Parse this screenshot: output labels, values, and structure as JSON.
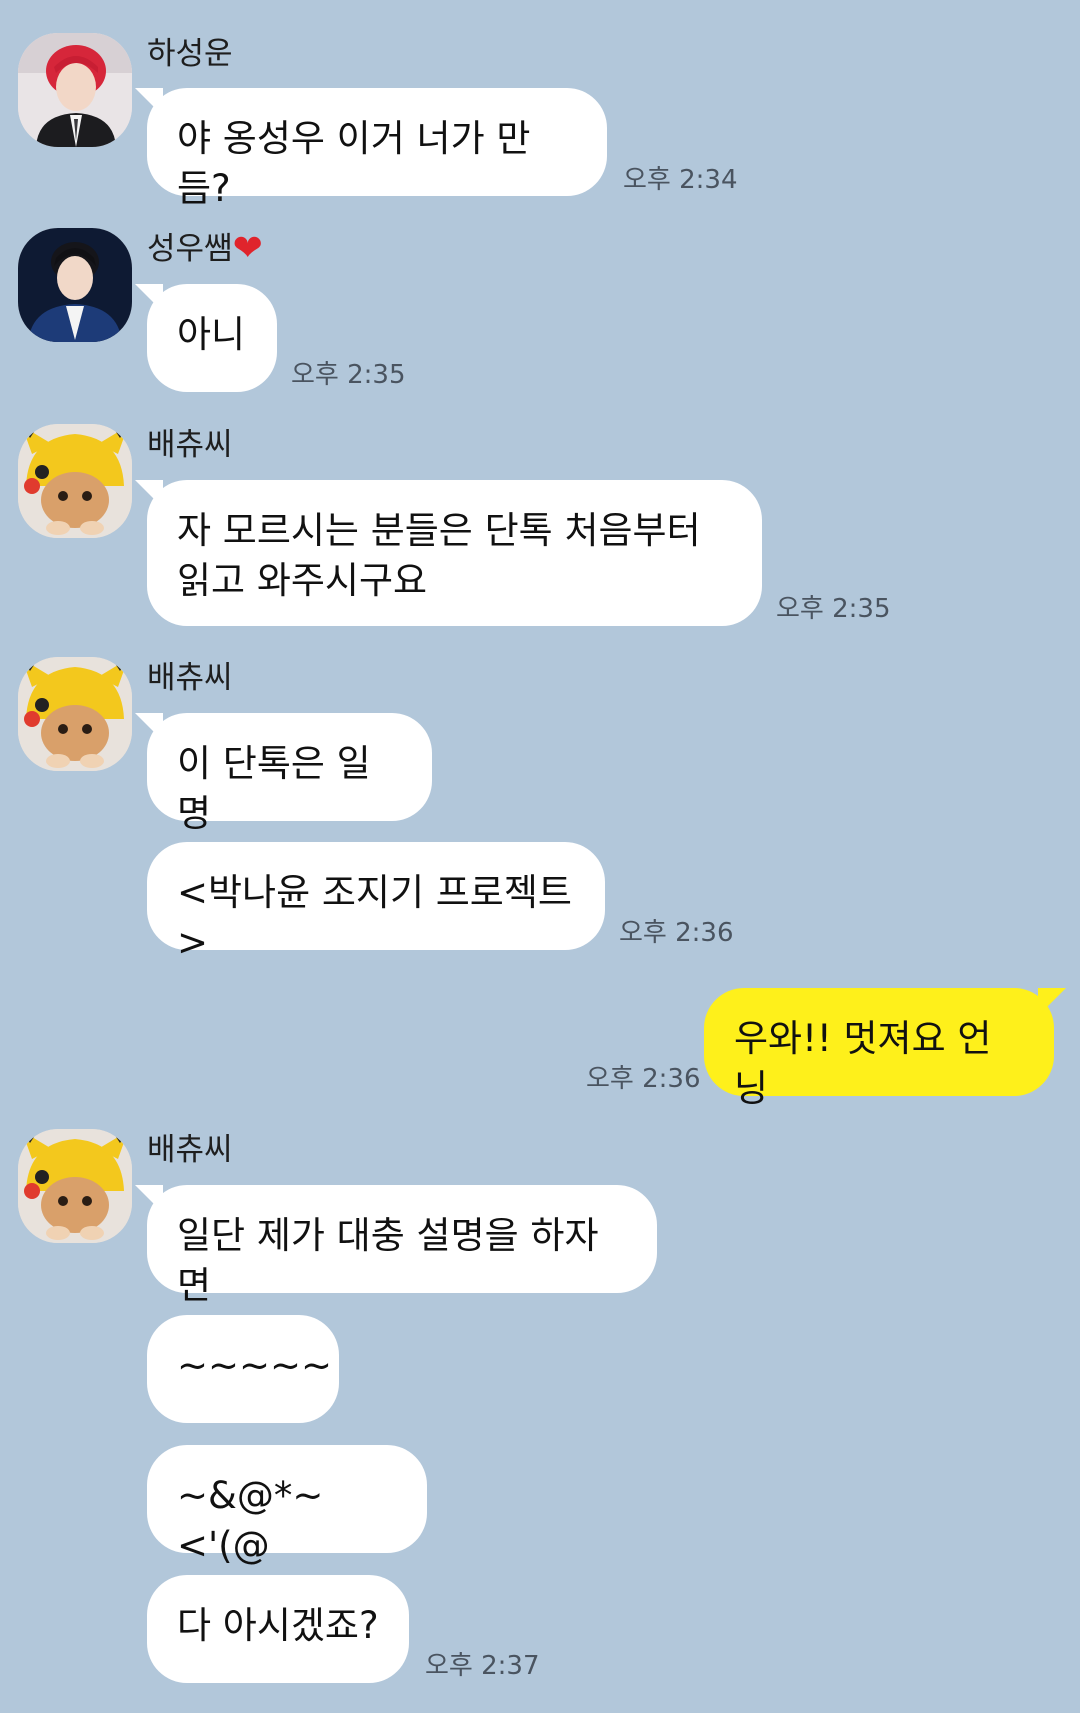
{
  "background_color": "#b2c7da",
  "bubble_colors": {
    "other": "#ffffff",
    "mine": "#fef01b"
  },
  "messages": [
    {
      "sender": "하성운",
      "text": "야 옹성우 이거 너가 만듬?",
      "time": "오후 2:34"
    },
    {
      "sender": "성우쌤",
      "sender_emoji": "❤",
      "text": "아니",
      "time": "오후 2:35"
    },
    {
      "sender": "배츄씨",
      "text": "자 모르시는 분들은 단톡 처음부터\n읽고 와주시구요",
      "time": "오후 2:35"
    },
    {
      "sender": "배츄씨",
      "text": "이 단톡은 일명"
    },
    {
      "text": "<박나윤 조지기 프로젝트>",
      "time": "오후 2:36"
    },
    {
      "mine": true,
      "text": "우와!! 멋져요 언닝",
      "time": "오후 2:36"
    },
    {
      "sender": "배츄씨",
      "text": "일단 제가 대충 설명을 하자면"
    },
    {
      "text": "~~~~~"
    },
    {
      "text": "~&@*~<'(@"
    },
    {
      "text": "다 아시겠죠?",
      "time": "오후 2:37"
    }
  ]
}
